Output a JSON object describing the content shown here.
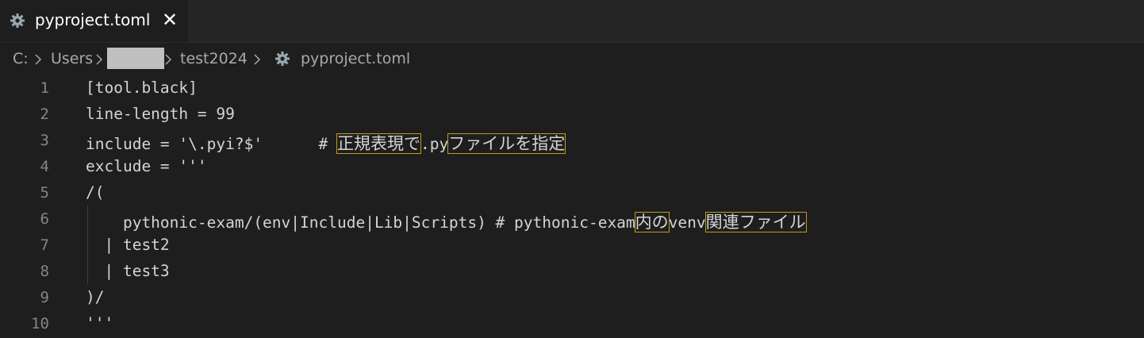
{
  "tab": {
    "title": "pyproject.toml",
    "close": "✕"
  },
  "breadcrumb": {
    "drive": "C:",
    "folder1": "Users",
    "folder3": "test2024",
    "file": "pyproject.toml"
  },
  "lines": [
    {
      "num": "1",
      "text": "[tool.black]"
    },
    {
      "num": "2",
      "text": "line-length = 99"
    },
    {
      "num": "3",
      "pre": "include = '\\.pyi?$'      # ",
      "jp1": "正規表現で",
      "mid": ".py",
      "jp2": "ファイルを指定"
    },
    {
      "num": "4",
      "text": "exclude = '''"
    },
    {
      "num": "5",
      "text": "/("
    },
    {
      "num": "6",
      "pre": "    pythonic-exam/(env|Include|Lib|Scripts) # pythonic-exam",
      "jp1": "内の",
      "mid": "venv",
      "jp2": "関連ファイル"
    },
    {
      "num": "7",
      "text": "  | test2"
    },
    {
      "num": "8",
      "text": "  | test3"
    },
    {
      "num": "9",
      "text": ")/"
    },
    {
      "num": "10",
      "text": "'''"
    }
  ],
  "colors": {
    "background": "#1e1e1e",
    "highlight_border": "#c39a1d"
  },
  "icons": {
    "file": "gear-icon",
    "separator": "chevron-right-icon"
  }
}
